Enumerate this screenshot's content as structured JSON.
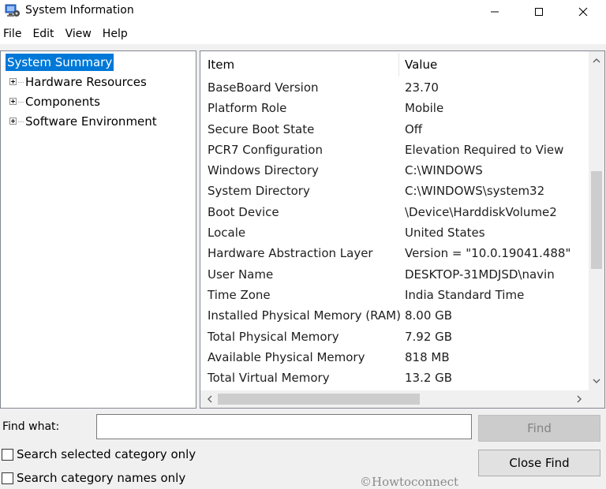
{
  "window": {
    "title": "System Information",
    "icon": "system-information-app-icon"
  },
  "menu": [
    "File",
    "Edit",
    "View",
    "Help"
  ],
  "tree": {
    "root": "System Summary",
    "children": [
      "Hardware Resources",
      "Components",
      "Software Environment"
    ]
  },
  "list": {
    "columns": [
      "Item",
      "Value"
    ],
    "rows": [
      {
        "item": "BaseBoard Version",
        "value": "23.70"
      },
      {
        "item": "Platform Role",
        "value": "Mobile"
      },
      {
        "item": "Secure Boot State",
        "value": "Off"
      },
      {
        "item": "PCR7 Configuration",
        "value": "Elevation Required to View"
      },
      {
        "item": "Windows Directory",
        "value": "C:\\WINDOWS"
      },
      {
        "item": "System Directory",
        "value": "C:\\WINDOWS\\system32"
      },
      {
        "item": "Boot Device",
        "value": "\\Device\\HarddiskVolume2"
      },
      {
        "item": "Locale",
        "value": "United States"
      },
      {
        "item": "Hardware Abstraction Layer",
        "value": "Version = \"10.0.19041.488\""
      },
      {
        "item": "User Name",
        "value": "DESKTOP-31MDJSD\\navin"
      },
      {
        "item": "Time Zone",
        "value": "India Standard Time"
      },
      {
        "item": "Installed Physical Memory (RAM)",
        "value": "8.00 GB"
      },
      {
        "item": "Total Physical Memory",
        "value": "7.92 GB"
      },
      {
        "item": "Available Physical Memory",
        "value": "818 MB"
      },
      {
        "item": "Total Virtual Memory",
        "value": "13.2 GB"
      }
    ]
  },
  "find": {
    "label": "Find what:",
    "value": "",
    "find_button": "Find",
    "close_find_button": "Close Find",
    "option_selected_category": "Search selected category only",
    "option_category_names": "Search category names only"
  },
  "watermark": "©Howtoconnect",
  "colors": {
    "selection": "#0078d7",
    "panel_border": "#828790",
    "disabled_button": "#cccccc"
  }
}
